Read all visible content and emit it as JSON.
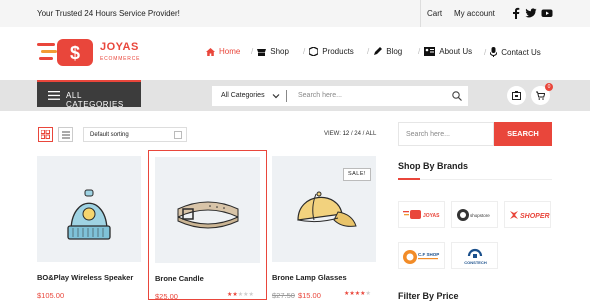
{
  "topbar": {
    "tagline": "Your Trusted 24 Hours Service Provider!",
    "cart": "Cart",
    "account": "My account",
    "social_icons": [
      "facebook-icon",
      "twitter-icon",
      "youtube-icon"
    ]
  },
  "logo": {
    "name": "JOYAS",
    "sub": "ECOMMERCE"
  },
  "nav": [
    {
      "label": "Home",
      "icon": "home-icon"
    },
    {
      "label": "Shop",
      "icon": "shop-icon"
    },
    {
      "label": "Products",
      "icon": "products-icon"
    },
    {
      "label": "Blog",
      "icon": "blog-icon"
    },
    {
      "label": "About Us",
      "icon": "about-icon"
    },
    {
      "label": "Contact Us",
      "icon": "contact-icon"
    }
  ],
  "searchbar": {
    "all_categories": "ALL CATEGORIES",
    "category_select": "All Categories",
    "placeholder": "Search here...",
    "cart_count": "0"
  },
  "toolbar": {
    "sort": "Default sorting",
    "view_label": "VIEW:",
    "view_12": "12",
    "view_rest": "/ 24 / ALL"
  },
  "products": [
    {
      "title": "BO&Play Wireless Speaker",
      "price": "$105.00",
      "old_price": "",
      "rating": 0,
      "sale": ""
    },
    {
      "title": "Brone Candle",
      "price": "$25.00",
      "old_price": "",
      "rating": 2,
      "sale": ""
    },
    {
      "title": "Brone Lamp Glasses",
      "price": "$15.00",
      "old_price": "$27.50",
      "rating": 4,
      "sale": "SALE!"
    }
  ],
  "sidebar": {
    "search_placeholder": "Search here...",
    "search_button": "SEARCH",
    "brands_title": "Shop By Brands",
    "brands": [
      "JOYAS",
      "shopstore",
      "SHOPER",
      "C.F SHOP",
      "CONSTECH"
    ],
    "filter_title": "Filter By Price"
  },
  "colors": {
    "accent": "#e9463b",
    "dark": "#3c3c3c"
  }
}
